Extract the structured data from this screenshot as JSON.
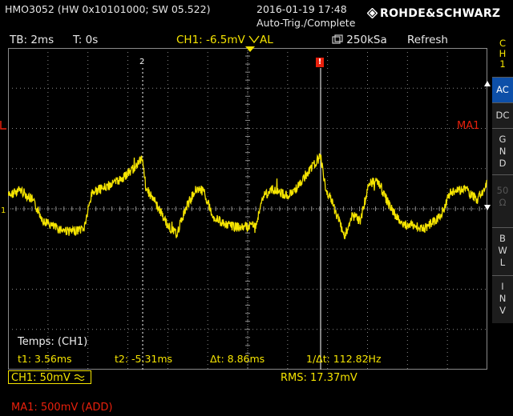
{
  "header": {
    "device_id": "HMO3052 (HW 0x10101000; SW 05.522)",
    "date": "2016-01-19 17:48",
    "trigger_status": "Auto-Trig./Complete",
    "brand": "ROHDE&SCHWARZ"
  },
  "status": {
    "timebase": "TB: 2ms",
    "trigger_time": "T: 0s",
    "ch1_trigger": "CH1: -6.5mV",
    "coupling": "AL",
    "sample_rate": "250kSa",
    "mode": "Refresh"
  },
  "right_panel": {
    "channel": [
      "C",
      "H",
      "1"
    ],
    "buttons": [
      {
        "label": [
          "AC"
        ],
        "active": true
      },
      {
        "label": [
          "DC"
        ],
        "active": false
      },
      {
        "label": [
          "G",
          "N",
          "D"
        ],
        "active": false
      },
      {
        "label": [
          "50",
          "Ω"
        ],
        "active": false,
        "dim": true
      },
      {
        "label": [
          "B",
          "W",
          "L"
        ],
        "active": false
      },
      {
        "label": [
          "I",
          "N",
          "V"
        ],
        "active": false
      }
    ]
  },
  "markers": {
    "cursor2": "2",
    "trigger": "!",
    "ch1_marker": "1",
    "ma1_marker": "M"
  },
  "math_label": "MA1",
  "cursor_readout": {
    "title": "Temps: (CH1)",
    "t1": "t1: 3.56ms",
    "t2": "t2: -5.31ms",
    "dt": "Δt: 8.86ms",
    "inv_dt": "1/Δt: 112.82Hz"
  },
  "bottom": {
    "ch1_scale": "CH1: 50mV",
    "rms": "RMS: 17.37mV",
    "ma1_scale": "MA1: 500mV (ADD)"
  },
  "colors": {
    "ch1": "#f5e400",
    "math": "#e8200c",
    "active_button": "#0d4fa8",
    "grid": "#8a8a8a"
  }
}
